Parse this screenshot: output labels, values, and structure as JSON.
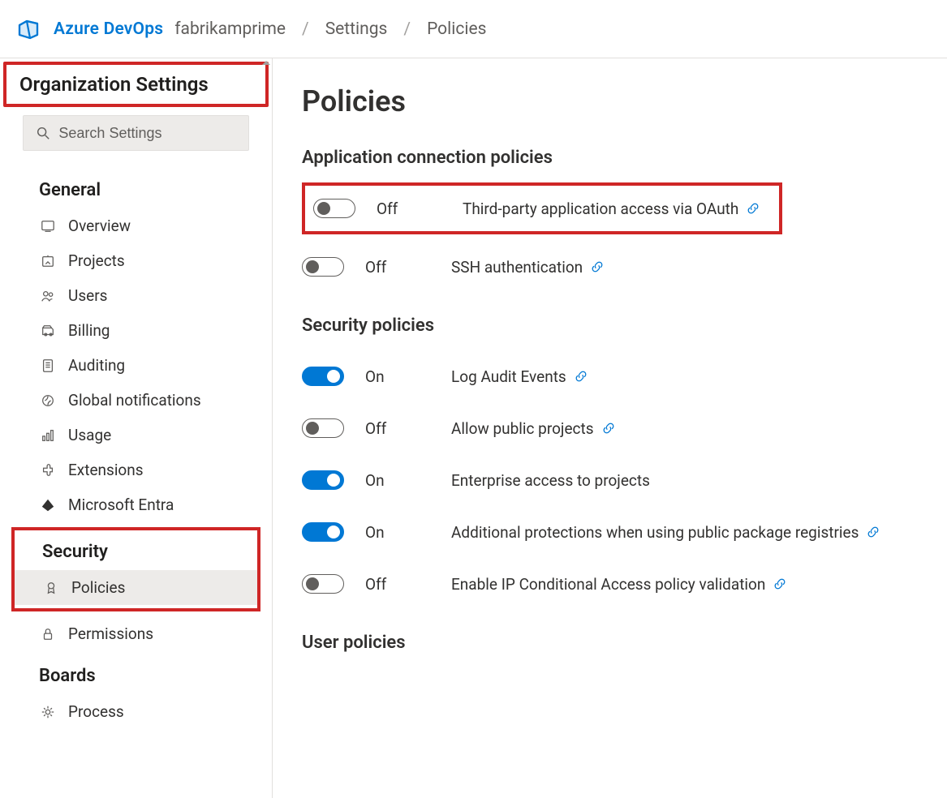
{
  "header": {
    "brand": "Azure DevOps",
    "org": "fabrikamprime",
    "crumb1": "Settings",
    "crumb2": "Policies"
  },
  "sidebar": {
    "title": "Organization Settings",
    "search_placeholder": "Search Settings",
    "groups": {
      "general": {
        "title": "General",
        "items": {
          "overview": "Overview",
          "projects": "Projects",
          "users": "Users",
          "billing": "Billing",
          "auditing": "Auditing",
          "global_notifications": "Global notifications",
          "usage": "Usage",
          "extensions": "Extensions",
          "entra": "Microsoft Entra"
        }
      },
      "security": {
        "title": "Security",
        "items": {
          "policies": "Policies",
          "permissions": "Permissions"
        }
      },
      "boards": {
        "title": "Boards",
        "items": {
          "process": "Process"
        }
      }
    }
  },
  "content": {
    "title": "Policies",
    "sections": {
      "app_conn": {
        "title": "Application connection policies",
        "rows": {
          "oauth": {
            "state": "Off",
            "label": "Third-party application access via OAuth",
            "on": false,
            "link": true
          },
          "ssh": {
            "state": "Off",
            "label": "SSH authentication",
            "on": false,
            "link": true
          }
        }
      },
      "sec": {
        "title": "Security policies",
        "rows": {
          "audit": {
            "state": "On",
            "label": "Log Audit Events",
            "on": true,
            "link": true
          },
          "pubproj": {
            "state": "Off",
            "label": "Allow public projects",
            "on": false,
            "link": true
          },
          "entacc": {
            "state": "On",
            "label": "Enterprise access to projects",
            "on": true,
            "link": false
          },
          "pkgprot": {
            "state": "On",
            "label": "Additional protections when using public package registries",
            "on": true,
            "link": true
          },
          "ipcap": {
            "state": "Off",
            "label": "Enable IP Conditional Access policy validation",
            "on": false,
            "link": true
          }
        }
      },
      "user": {
        "title": "User policies"
      }
    }
  }
}
